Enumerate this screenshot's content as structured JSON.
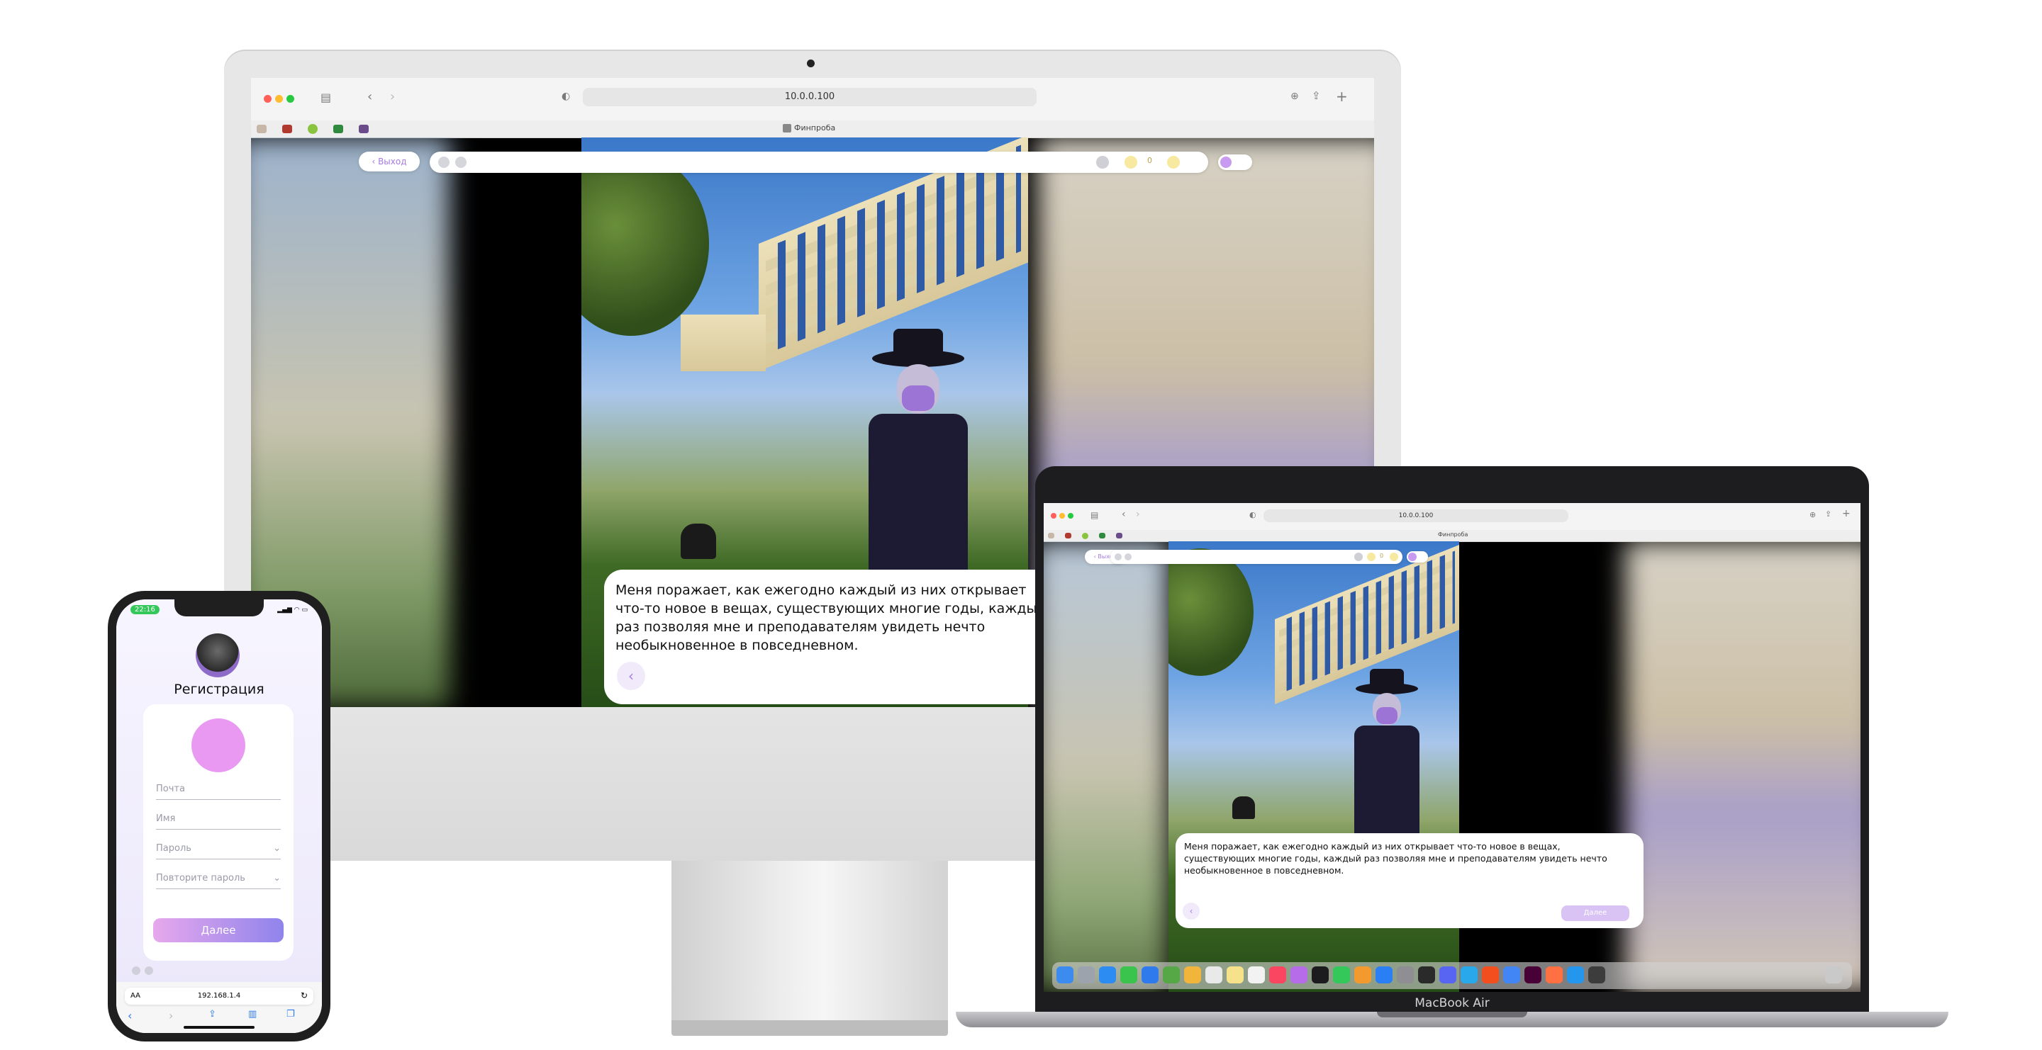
{
  "imac": {
    "url": "10.0.0.100",
    "tab_title": "Финпроба",
    "exit_label": "Выход",
    "coins": "0",
    "dialog_text": "Меня поражает, как ежегодно каждый из них открывает что-то новое в вещах, существующих многие годы, каждый раз позволяя мне и преподавателям увидеть нечто необыкновенное в повседневном."
  },
  "macbook": {
    "url": "10.0.0.100",
    "tab_title": "Финпроба",
    "exit_label": "Выход",
    "coins": "0",
    "dialog_text": "Меня поражает, как ежегодно каждый из них открывает что-то новое в вещах, существующих многие годы, каждый раз позволяя мне и преподавателям увидеть нечто необыкновенное в повседневном.",
    "next_label": "Далее",
    "device_label": "MacBook Air"
  },
  "iphone": {
    "time": "22:16",
    "title": "Регистрация",
    "email_placeholder": "Почта",
    "name_placeholder": "Имя",
    "password_placeholder": "Пароль",
    "repeat_password_placeholder": "Повторите пароль",
    "next_label": "Далее",
    "text_size": "AA",
    "url": "192.168.1.4"
  },
  "colors": {
    "accent_purple": "#a67be0",
    "avatar_pink": "#e999f2",
    "button_gradient_start": "#e7a8ec",
    "button_gradient_end": "#8f84ec",
    "coin_yellow": "#f3d43c"
  }
}
